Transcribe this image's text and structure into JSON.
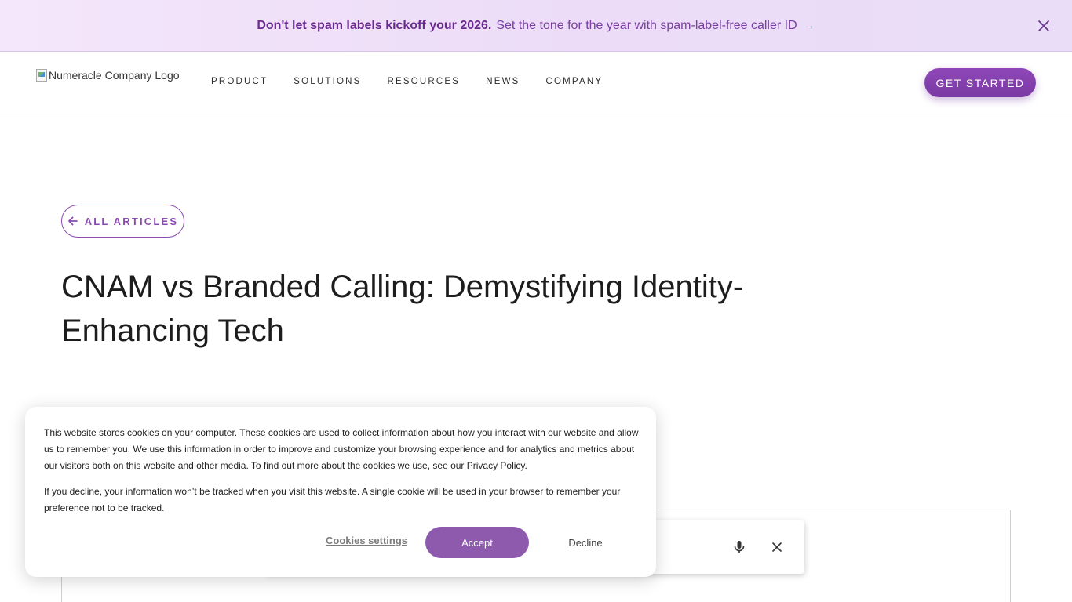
{
  "announcement": {
    "bold": "Don't let spam labels kickoff your 2026.",
    "text": "Set the tone for the year with spam-label-free caller ID",
    "arrow": "→",
    "close_icon": "close-icon"
  },
  "header": {
    "logo_alt": "Numeracle Company Logo",
    "nav": [
      "PRODUCT",
      "SOLUTIONS",
      "RESOURCES",
      "NEWS",
      "COMPANY"
    ],
    "cta": "GET STARTED"
  },
  "article": {
    "back_label": "ALL ARTICLES",
    "title": "CNAM vs Branded Calling: Demystifying Identity-Enhancing Tech"
  },
  "cookie_banner": {
    "paragraph1": "This website stores cookies on your computer. These cookies are used to collect information about how you interact with our website and allow us to remember you. We use this information in order to improve and customize your browsing experience and for analytics and metrics about our visitors both on this website and other media. To find out more about the cookies we use, see our Privacy Policy.",
    "paragraph2": "If you decline, your information won’t be tracked when you visit this website. A single cookie will be used in your browser to remember your preference not to be tracked.",
    "settings_label": "Cookies settings",
    "accept_label": "Accept",
    "decline_label": "Decline"
  },
  "search_widget": {
    "mic_icon": "microphone-icon",
    "close_icon": "close-icon"
  },
  "colors": {
    "brand_purple": "#7a3aa3",
    "accent_teal": "#3ec1b6",
    "accept_purple": "#8e5aae"
  }
}
